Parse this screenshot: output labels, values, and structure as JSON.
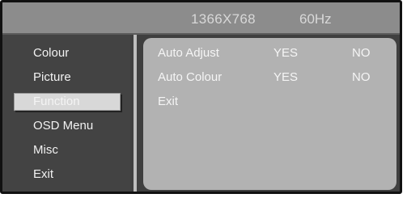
{
  "header": {
    "resolution": "1366X768",
    "refresh_rate": "60Hz"
  },
  "menu": {
    "items": [
      {
        "label": "Colour",
        "selected": false
      },
      {
        "label": "Picture",
        "selected": false
      },
      {
        "label": "Function",
        "selected": true
      },
      {
        "label": "OSD Menu",
        "selected": false
      },
      {
        "label": "Misc",
        "selected": false
      },
      {
        "label": "Exit",
        "selected": false
      }
    ]
  },
  "function_panel": {
    "rows": [
      {
        "label": "Auto Adjust",
        "yes": "YES",
        "no": "NO"
      },
      {
        "label": "Auto Colour",
        "yes": "YES",
        "no": "NO"
      },
      {
        "label": "Exit"
      }
    ]
  },
  "colors": {
    "osd_background": "#3f3f3f",
    "header_bar": "#8c8c8c",
    "content_panel": "#b2b2b2",
    "selection_highlight": "#d8d8d8"
  }
}
